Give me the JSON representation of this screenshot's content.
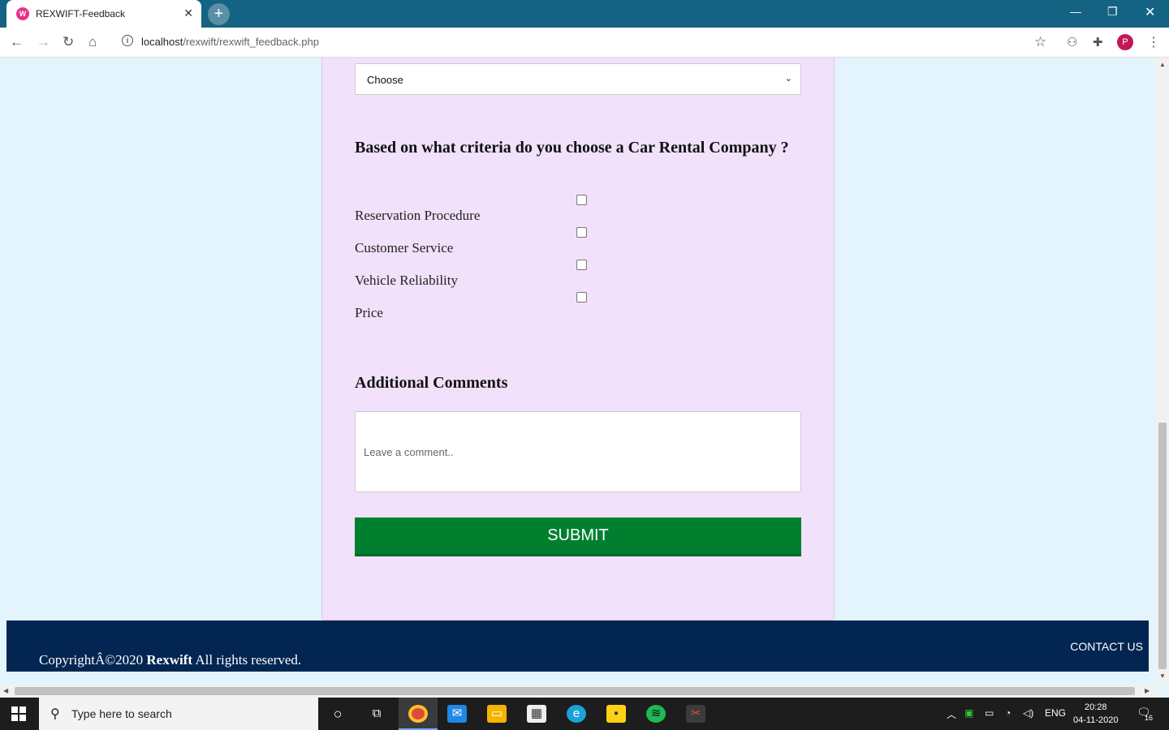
{
  "browser": {
    "tab_title": "REXWIFT-Feedback",
    "tab_favicon_letter": "W",
    "url_host": "localhost",
    "url_path": "/rexwift/rexwift_feedback.php",
    "profile_initial": "P"
  },
  "form": {
    "select_value": "Choose",
    "criteria_question": "Based on what criteria do you choose a Car Rental Company ?",
    "criteria_options": [
      {
        "label": "Reservation Procedure",
        "checked": false
      },
      {
        "label": "Customer Service",
        "checked": false
      },
      {
        "label": "Vehicle Reliability",
        "checked": false
      },
      {
        "label": "Price",
        "checked": false
      }
    ],
    "comments_title": "Additional Comments",
    "comments_placeholder": "Leave a comment..",
    "submit_label": "SUBMIT"
  },
  "footer": {
    "copyright_prefix": "CopyrightÂ©2020 ",
    "brand": "Rexwift",
    "copyright_suffix": " All rights reserved.",
    "contact_label": "CONTACT US"
  },
  "taskbar": {
    "search_placeholder": "Type here to search",
    "language": "ENG",
    "time": "20:28",
    "date": "04-11-2020",
    "notification_count": "16"
  },
  "colors": {
    "chrome_titlebar": "#146383",
    "page_bg": "#e3f4fc",
    "card_bg": "#f1e1fb",
    "submit_bg": "#00802f",
    "footer_bg": "#022651"
  }
}
